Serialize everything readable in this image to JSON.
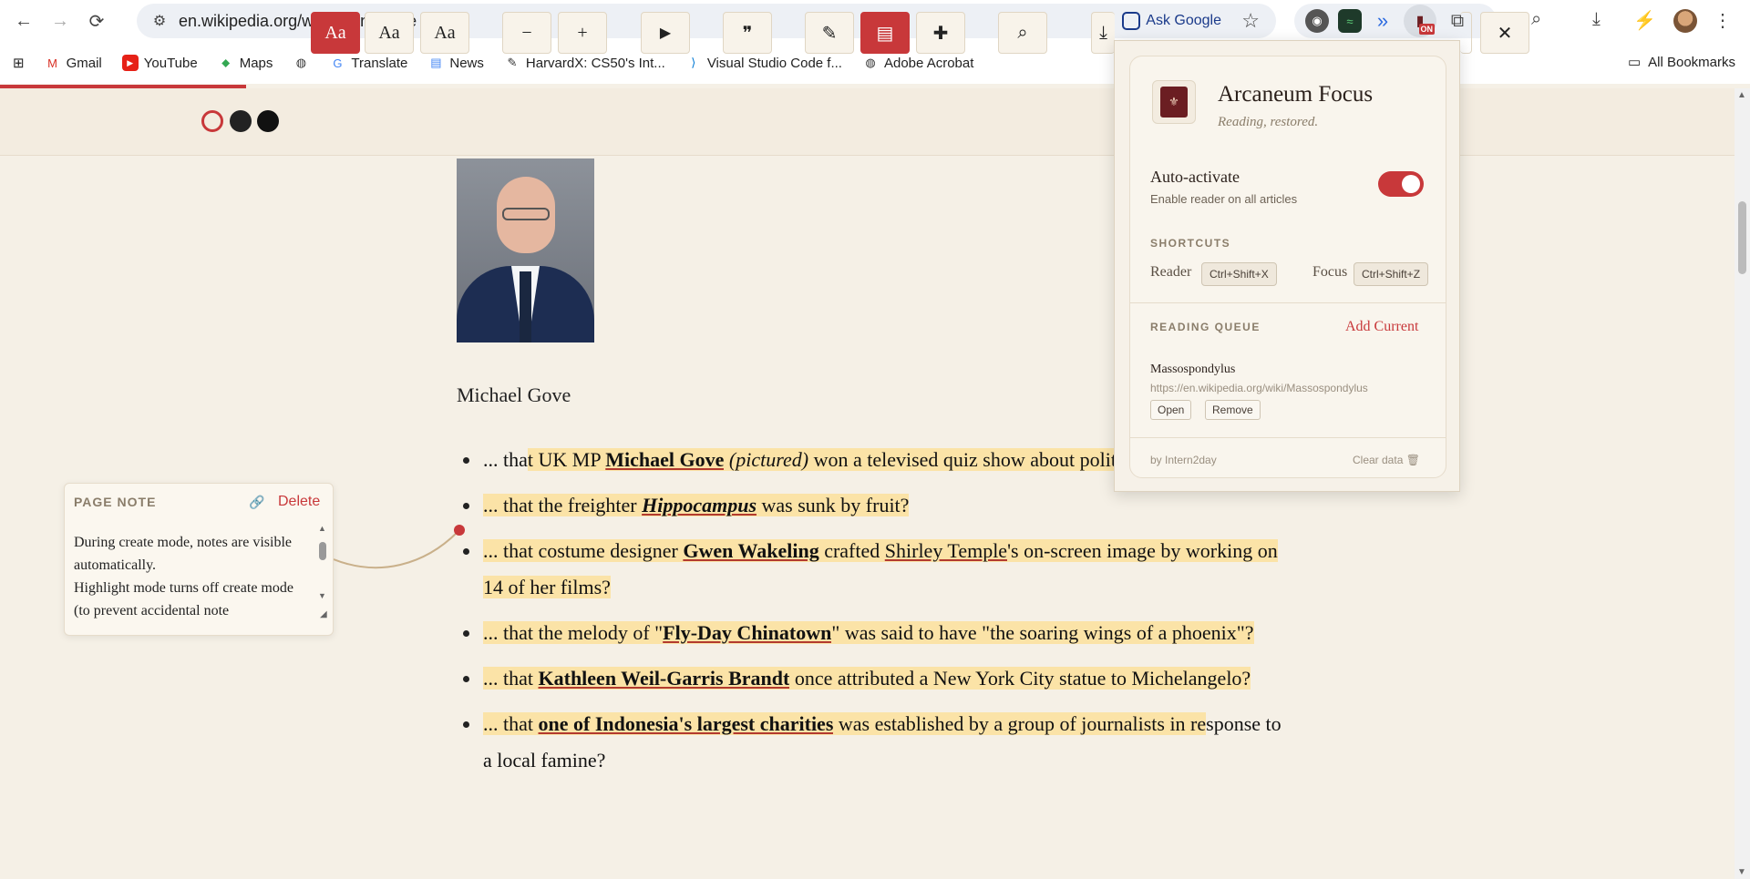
{
  "browser": {
    "url": "en.wikipedia.org/wiki/Main_Page",
    "ask_google": "Ask Google",
    "extension_badge": "ON"
  },
  "bookmarks": [
    {
      "label": "Gmail",
      "icon": "gmail-icon"
    },
    {
      "label": "YouTube",
      "icon": "youtube-icon"
    },
    {
      "label": "Maps",
      "icon": "maps-icon"
    },
    {
      "label": "",
      "icon": "globe-icon"
    },
    {
      "label": "Translate",
      "icon": "translate-icon"
    },
    {
      "label": "News",
      "icon": "news-icon"
    },
    {
      "label": "HarvardX: CS50's Int...",
      "icon": "harvardx-icon"
    },
    {
      "label": "Visual Studio Code f...",
      "icon": "vscode-icon"
    },
    {
      "label": "Adobe Acrobat",
      "icon": "globe-icon"
    }
  ],
  "all_bookmarks": "All Bookmarks",
  "reader_toolbar": {
    "font_labels": [
      "Aa",
      "Aa",
      "Aa"
    ],
    "minus": "−",
    "plus": "+",
    "play": "▶",
    "quote": "❞",
    "close": "✕"
  },
  "article": {
    "caption": "Michael Gove",
    "items": [
      [
        {
          "t": "... tha",
          "c": ""
        },
        {
          "t": "t UK MP ",
          "c": "hl"
        },
        {
          "t": "Michael Gove",
          "c": "hl b"
        },
        {
          "t": " ",
          "c": "hl"
        },
        {
          "t": "(pictured)",
          "c": "hl i"
        },
        {
          "t": " won a televised quiz show",
          "c": "hl"
        },
        {
          "t": " about politics?",
          "c": "hl"
        }
      ],
      [
        {
          "t": "... that the freighter ",
          "c": "hl"
        },
        {
          "t": "Hippocampus",
          "c": "hl b i"
        },
        {
          "t": " was sunk by fruit?",
          "c": "hl"
        }
      ],
      [
        {
          "t": "... that costume designer ",
          "c": "hl"
        },
        {
          "t": "Gwen Wakeling",
          "c": "hl b"
        },
        {
          "t": " crafted ",
          "c": "hl"
        },
        {
          "t": "Shirley Temple",
          "c": "hl u"
        },
        {
          "t": "'s on-screen image by working on 14 of her films?",
          "c": "hl"
        }
      ],
      [
        {
          "t": "... that the melody of \"",
          "c": "hl"
        },
        {
          "t": "Fly-Day Chinatown",
          "c": "hl b"
        },
        {
          "t": "\" was said to have \"the soaring wings of a phoenix\"?",
          "c": "hl"
        }
      ],
      [
        {
          "t": "... that ",
          "c": "hl"
        },
        {
          "t": "Kathleen Weil-Garris Brandt",
          "c": "hl b"
        },
        {
          "t": " once attributed a New York City statue to Michelangelo?",
          "c": "hl"
        }
      ],
      [
        {
          "t": "... that ",
          "c": "hl"
        },
        {
          "t": "one of Indonesia's largest charities",
          "c": "hl b"
        },
        {
          "t": " was established by a group of journalists in re",
          "c": "hl"
        },
        {
          "t": "sponse to a local famine?",
          "c": ""
        }
      ]
    ]
  },
  "page_note": {
    "title": "PAGE NOTE",
    "delete": "Delete",
    "text": "During create mode, notes are visible automatically.\nHighlight mode turns off create mode (to prevent accidental note"
  },
  "popup": {
    "title": "Arcaneum Focus",
    "subtitle": "Reading, restored.",
    "auto_label": "Auto-activate",
    "auto_sub": "Enable reader on all articles",
    "auto_on": true,
    "shortcuts_title": "SHORTCUTS",
    "reader_label": "Reader",
    "reader_key": "Ctrl+Shift+X",
    "focus_label": "Focus",
    "focus_key": "Ctrl+Shift+Z",
    "queue_title": "READING QUEUE",
    "add_current": "Add Current",
    "queue_item_title": "Massospondylus",
    "queue_item_url": "https://en.wikipedia.org/wiki/Massospondylus",
    "open": "Open",
    "remove": "Remove",
    "by": "by Intern2day",
    "clear": "Clear data"
  },
  "colors": {
    "accent": "#c8383a",
    "page_bg": "#f5f0e6",
    "highlight": "#fbe3a7"
  }
}
